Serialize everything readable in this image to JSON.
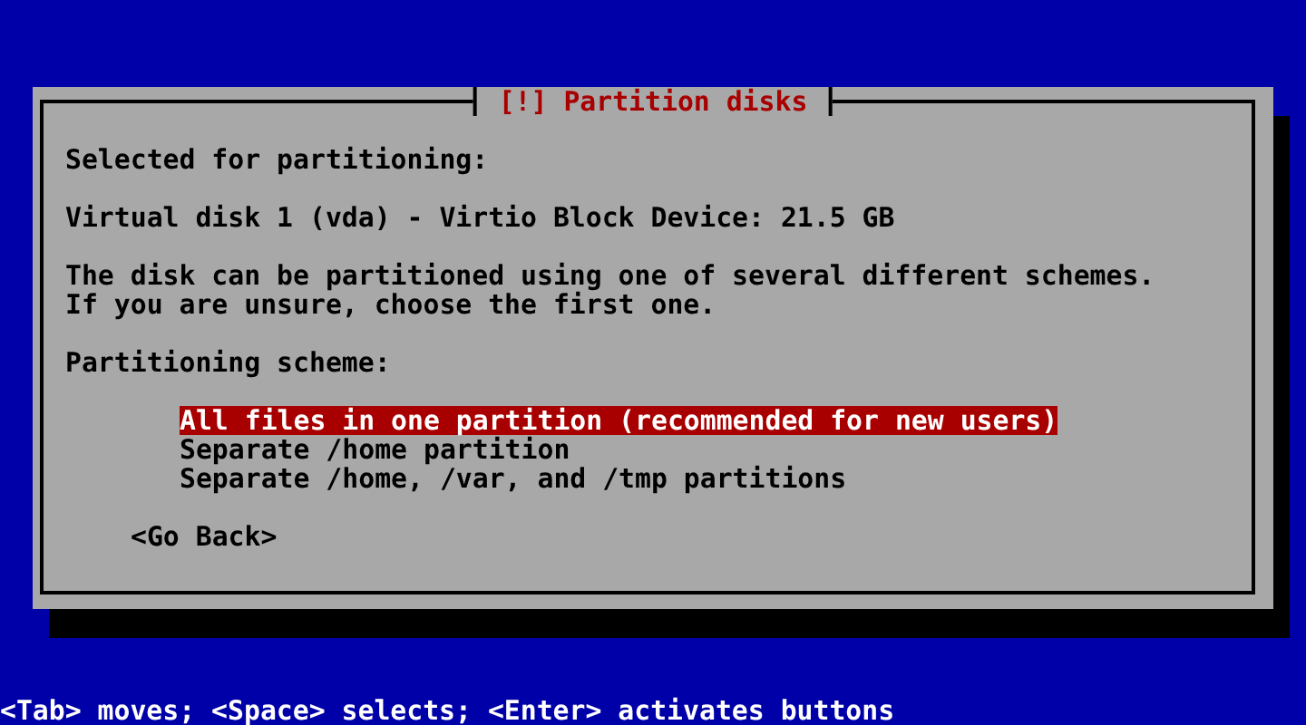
{
  "dialog": {
    "title": "[!] Partition disks",
    "paragraphs": [
      [
        "Selected for partitioning:"
      ],
      [
        "Virtual disk 1 (vda) - Virtio Block Device: 21.5 GB"
      ],
      [
        "The disk can be partitioned using one of several different schemes.",
        "If you are unsure, choose the first one."
      ]
    ],
    "scheme_label": "Partitioning scheme:",
    "options": [
      {
        "label": "All files in one partition (recommended for new users)",
        "selected": true
      },
      {
        "label": "Separate /home partition",
        "selected": false
      },
      {
        "label": "Separate /home, /var, and /tmp partitions",
        "selected": false
      }
    ],
    "back_button": "<Go Back>"
  },
  "help_line": "<Tab> moves; <Space> selects; <Enter> activates buttons"
}
